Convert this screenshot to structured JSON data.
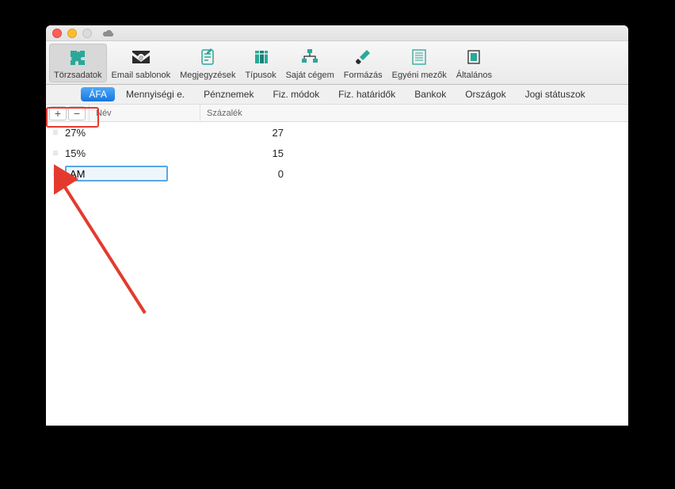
{
  "toolbar": {
    "items": [
      {
        "label": "Törzsadatok"
      },
      {
        "label": "Email sablonok"
      },
      {
        "label": "Megjegyzések"
      },
      {
        "label": "Típusok"
      },
      {
        "label": "Saját cégem"
      },
      {
        "label": "Formázás"
      },
      {
        "label": "Egyéni mezők"
      },
      {
        "label": "Általános"
      }
    ]
  },
  "tabs": [
    {
      "label": "ÁFA"
    },
    {
      "label": "Mennyiségi e."
    },
    {
      "label": "Pénznemek"
    },
    {
      "label": "Fiz. módok"
    },
    {
      "label": "Fiz. határidők"
    },
    {
      "label": "Bankok"
    },
    {
      "label": "Országok"
    },
    {
      "label": "Jogi státuszok"
    }
  ],
  "columns": {
    "nev": "Név",
    "szazalek": "Százalék"
  },
  "buttons": {
    "plus": "+",
    "minus": "−"
  },
  "rows": [
    {
      "name": "27%",
      "percent": "27"
    },
    {
      "name": "15%",
      "percent": "15"
    },
    {
      "name": "AM",
      "percent": "0",
      "editing": true
    }
  ]
}
